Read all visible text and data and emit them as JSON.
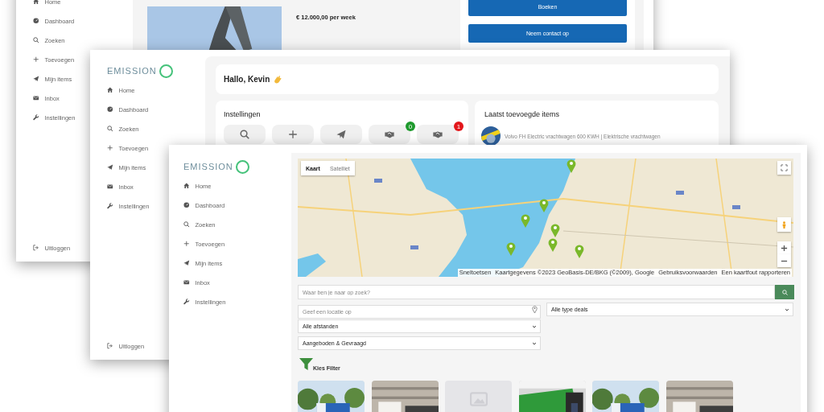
{
  "back_window": {
    "sidebar": {
      "items": [
        {
          "kind": "home",
          "label": "Home"
        },
        {
          "kind": "dashboard",
          "label": "Dashboard"
        },
        {
          "kind": "search",
          "label": "Zoeken"
        },
        {
          "kind": "add",
          "label": "Toevoegen"
        },
        {
          "kind": "send",
          "label": "Mijn items"
        },
        {
          "kind": "inbox",
          "label": "Inbox"
        },
        {
          "kind": "settings",
          "label": "Instellingen"
        }
      ],
      "logout": "Uitloggen"
    },
    "listing": {
      "price": "€ 12.000,00 per week"
    },
    "actions": [
      "Boeken",
      "Neem contact op"
    ]
  },
  "dashboard_window": {
    "sidebar": {
      "logo": "EMISSION",
      "items": [
        {
          "kind": "home",
          "label": "Home"
        },
        {
          "kind": "dashboard",
          "label": "Dashboard"
        },
        {
          "kind": "search",
          "label": "Zoeken"
        },
        {
          "kind": "add",
          "label": "Toevoegen"
        },
        {
          "kind": "send",
          "label": "Mijn items"
        },
        {
          "kind": "inbox",
          "label": "Inbox"
        },
        {
          "kind": "settings",
          "label": "Instellingen"
        }
      ],
      "logout": "Uitloggen"
    },
    "greeting": "Hallo, Kevin",
    "settings": {
      "title": "Instellingen",
      "tiles": [
        {
          "kind": "search"
        },
        {
          "kind": "add"
        },
        {
          "kind": "send"
        },
        {
          "kind": "handshake",
          "badge": "0",
          "color": "#1f9a2e"
        },
        {
          "kind": "handshake",
          "badge": "1",
          "color": "#e3161b"
        }
      ]
    },
    "latest": {
      "title": "Laatst toevoegde items",
      "items": [
        {
          "title": "Volvo FH Electric vrachtwagen 600 KWH | Elektrische vrachtwagen"
        }
      ]
    }
  },
  "search_window": {
    "sidebar": {
      "logo": "EMISSION",
      "items": [
        {
          "kind": "home",
          "label": "Home"
        },
        {
          "kind": "dashboard",
          "label": "Dashboard"
        },
        {
          "kind": "search",
          "label": "Zoeken"
        },
        {
          "kind": "add",
          "label": "Toevoegen"
        },
        {
          "kind": "send",
          "label": "Mijn items"
        },
        {
          "kind": "inbox",
          "label": "Inbox"
        },
        {
          "kind": "settings",
          "label": "Instellingen"
        }
      ]
    },
    "map": {
      "tabs": [
        {
          "label": "Kaart",
          "selected": true
        },
        {
          "label": "Satelliet",
          "selected": false
        }
      ],
      "attribution": [
        "Sneltoetsen",
        "Kaartgegevens ©2023 GeoBasis-DE/BKG (©2009), Google",
        "Gebruiksvoorwaarden",
        "Een kaartfout rapporteren"
      ]
    },
    "search": {
      "placeholder": "Waar ben je naar op zoek?"
    },
    "location": {
      "placeholder": "Geef een locatie op"
    },
    "deal_type": {
      "value": "Alle type deals"
    },
    "distance": {
      "value": "Alle afstanden"
    },
    "offer_type": {
      "value": "Aangeboden & Gevraagd"
    },
    "filter": "Kies Filter",
    "results": [
      {
        "kind": "picture"
      },
      {
        "kind": "picture"
      },
      {
        "kind": "placeholder"
      },
      {
        "kind": "picture"
      },
      {
        "kind": "picture"
      },
      {
        "kind": "picture"
      }
    ]
  }
}
